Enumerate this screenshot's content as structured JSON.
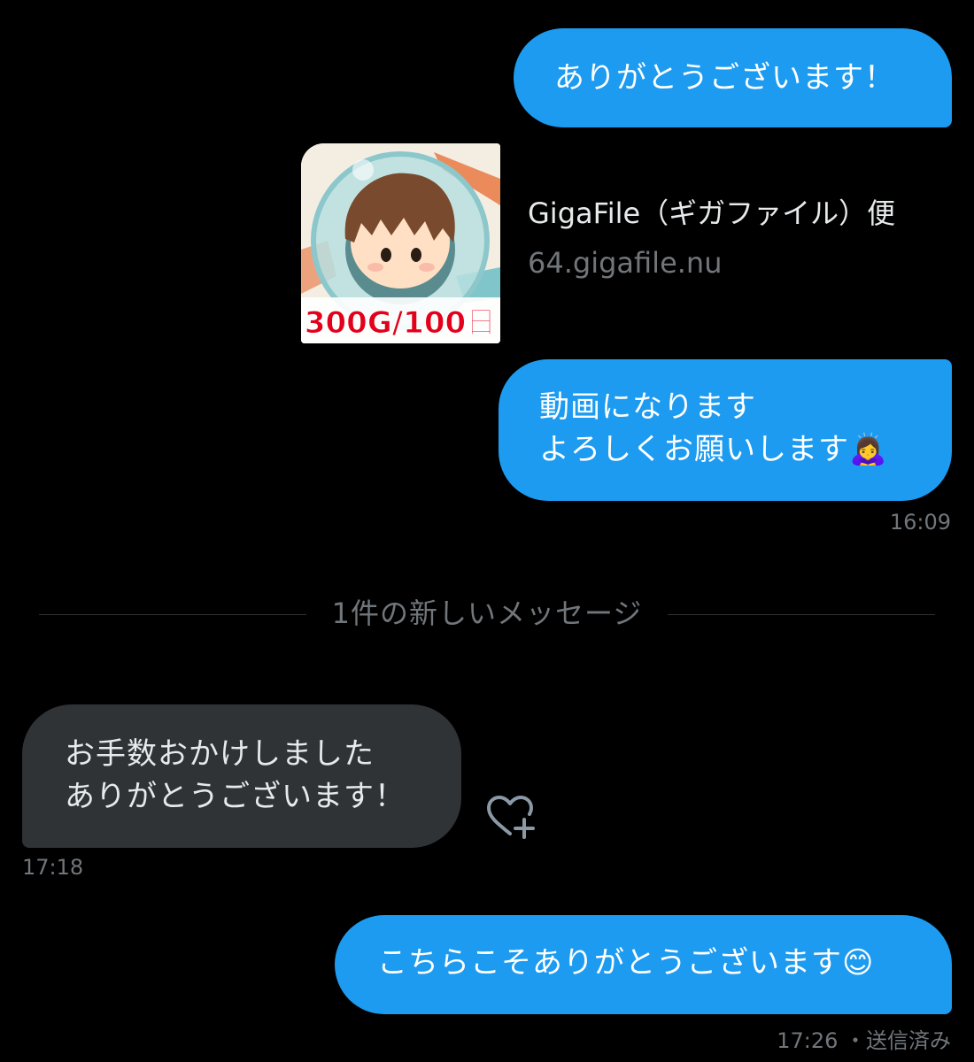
{
  "colors": {
    "background": "#000000",
    "outgoing_bubble": "#1d9bf0",
    "incoming_bubble": "#2f3336",
    "secondary_text": "#71767b"
  },
  "messages": [
    {
      "direction": "out",
      "lines": [
        "ありがとうございます！"
      ]
    },
    {
      "direction": "out",
      "lines": [
        "動画になります",
        "よろしくお願いします"
      ],
      "emoji": "🙇‍♀️",
      "time": "16:09"
    },
    {
      "direction": "in",
      "lines": [
        "お手数おかけしました",
        "ありがとうございます！"
      ],
      "time": "17:18"
    },
    {
      "direction": "out",
      "lines": [
        "こちらこそありがとうございます"
      ],
      "emoji": "😊",
      "time": "17:26",
      "status": "・送信済み"
    }
  ],
  "link_card": {
    "title": "GigaFile（ギガファイル）便",
    "domain": "64.gigafile.nu",
    "thumbnail_text": "300G/100日",
    "thumbnail_icon": "cartoon-astronaut-boy-icon"
  },
  "divider": {
    "text": "1件の新しいメッセージ"
  },
  "reaction_button": {
    "icon": "heart-plus-icon"
  }
}
